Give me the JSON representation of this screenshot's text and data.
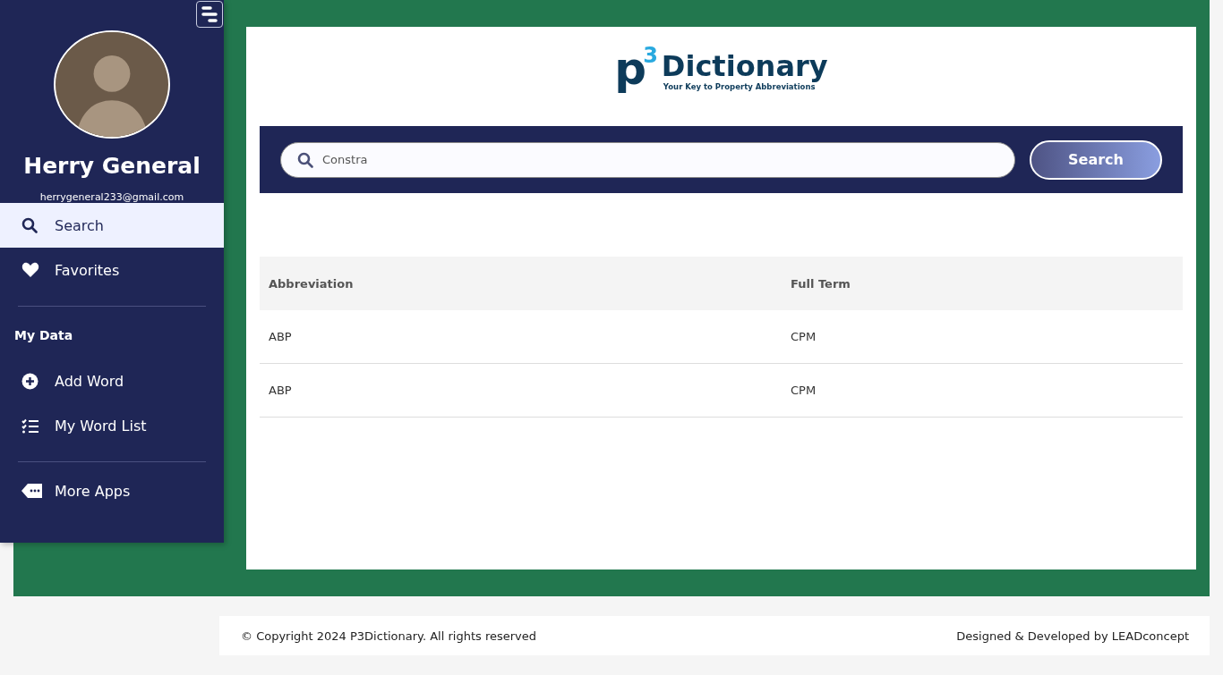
{
  "user": {
    "name": "Herry General",
    "email": "herrygeneral233@gmail.com"
  },
  "nav": [
    {
      "label": "Search",
      "kind": "search",
      "selected": true
    },
    {
      "label": "Favorites",
      "kind": "favorites",
      "selected": false
    }
  ],
  "section_title": "My Data",
  "data_nav": [
    {
      "label": "Add Word",
      "kind": "add",
      "selected": false
    },
    {
      "label": "My Word List",
      "kind": "list",
      "selected": false
    }
  ],
  "extra_nav": [
    {
      "label": "More Apps",
      "kind": "apps",
      "selected": false
    }
  ],
  "logo": {
    "letter": "p",
    "number": "3",
    "name": "Dictionary",
    "tagline": "Your Key to Property Abbreviations"
  },
  "search": {
    "value": "Constra",
    "button": "Search"
  },
  "table": {
    "columns": [
      "Abbreviation",
      "Full Term"
    ],
    "rows": [
      [
        "ABP",
        "CPM"
      ],
      [
        "ABP",
        "CPM"
      ]
    ]
  },
  "footer": {
    "copyright": "© Copyright 2024 P3Dictionary. All rights reserved",
    "credit": "Designed & Developed by LEADconcept"
  }
}
